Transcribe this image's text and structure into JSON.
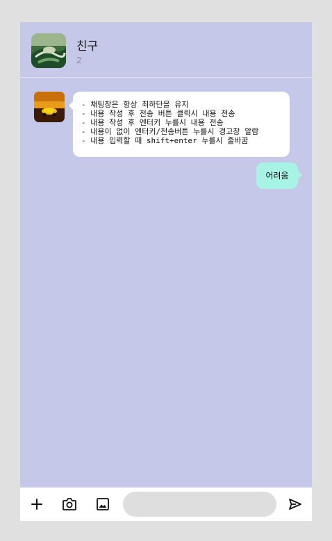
{
  "header": {
    "room_name": "친구",
    "member_count": "2"
  },
  "messages": {
    "received": {
      "lines": [
        "- 채팅창은 항상 최하단을 유지",
        "- 내용 작성 후 전송 버튼 클릭시 내용 전송",
        "- 내용 작성 후 엔터키 누를시 내용 전송",
        "- 내용이 없이 엔터키/전송버튼 누를시 경고창 알람",
        "- 내용 입력할 때 shift+enter 누를시 줄바꿈"
      ]
    },
    "sent": {
      "text": "어려움"
    }
  },
  "input_bar": {
    "icons": [
      "plus-icon",
      "camera-icon",
      "image-icon",
      "send-icon"
    ],
    "input_value": ""
  },
  "colors": {
    "page_background": "#e0e0e0",
    "chat_background": "#c5c8e8",
    "received_bubble": "#ffffff",
    "sent_bubble": "#a8f4e4",
    "input_background": "#dedede"
  }
}
